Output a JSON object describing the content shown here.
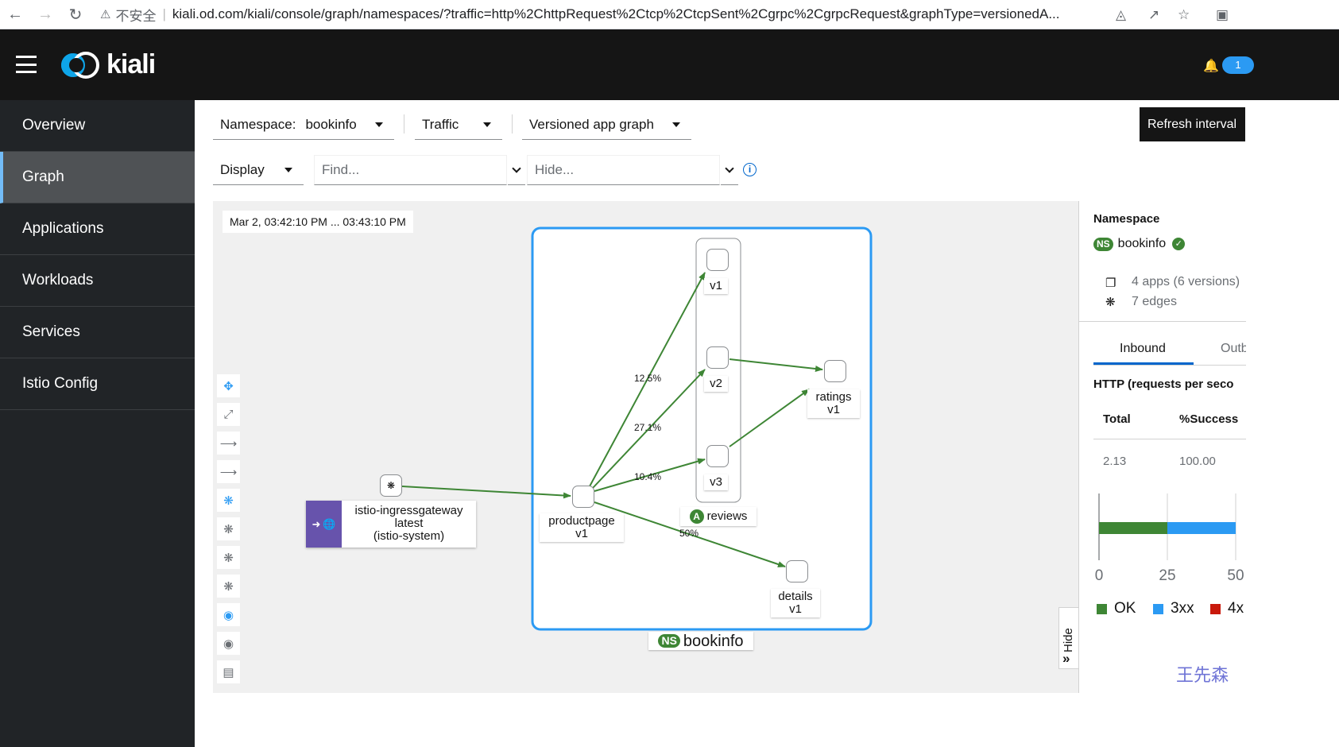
{
  "browser": {
    "insecure_label": "不安全",
    "url": "kiali.od.com/kiali/console/graph/namespaces/?traffic=http%2ChttpRequest%2Ctcp%2CtcpSent%2Cgrpc%2CgrpcRequest&graphType=versionedA..."
  },
  "masthead": {
    "logo_text": "kiali",
    "notification_count": "1"
  },
  "sidebar": {
    "items": [
      {
        "label": "Overview"
      },
      {
        "label": "Graph"
      },
      {
        "label": "Applications"
      },
      {
        "label": "Workloads"
      },
      {
        "label": "Services"
      },
      {
        "label": "Istio Config"
      }
    ],
    "active": "Graph"
  },
  "toolbar": {
    "namespace_label": "Namespace:",
    "namespace_value": "bookinfo",
    "traffic_label": "Traffic",
    "graph_type": "Versioned app graph",
    "display_label": "Display",
    "find_placeholder": "Find...",
    "hide_placeholder": "Hide...",
    "refresh_tooltip": "Refresh interval"
  },
  "graph": {
    "time_range": "Mar 2, 03:42:10 PM ... 03:43:10 PM",
    "namespace_box_label": "bookinfo",
    "ns_badge": "NS",
    "app_badge": "A",
    "nodes": {
      "gateway": {
        "line1": "istio-ingressgateway",
        "line2": "latest",
        "line3": "(istio-system)"
      },
      "productpage": {
        "line1": "productpage",
        "line2": "v1"
      },
      "reviews_v1": {
        "line1": "v1"
      },
      "reviews_v2": {
        "line1": "v2"
      },
      "reviews_v3": {
        "line1": "v3"
      },
      "reviews_app": {
        "line1": "reviews"
      },
      "ratings": {
        "line1": "ratings",
        "line2": "v1"
      },
      "details": {
        "line1": "details",
        "line2": "v1"
      }
    },
    "edge_labels": {
      "to_v1": "12.5%",
      "to_v2": "27.1%",
      "to_v3": "10.4%",
      "to_details": "50%"
    },
    "edge_color": "#3e8635",
    "namespace_box_color": "#2b9af3",
    "hide_label": "Hide"
  },
  "summary": {
    "title": "Namespace",
    "namespace_badge": "NS",
    "namespace_name": "bookinfo",
    "apps_stat": "4 apps (6 versions)",
    "edges_stat": "7 edges",
    "tabs": [
      "Inbound",
      "Outb"
    ],
    "active_tab": "Inbound",
    "http_heading": "HTTP (requests per seco",
    "table_headers": [
      "Total",
      "%Success"
    ],
    "table_values": [
      "2.13",
      "100.00"
    ],
    "watermark": "王先森"
  },
  "chart_data": {
    "type": "bar",
    "orientation": "horizontal",
    "stacked": true,
    "categories": [
      ""
    ],
    "series": [
      {
        "name": "OK",
        "color": "#3e8635",
        "values": [
          25
        ]
      },
      {
        "name": "3xx",
        "color": "#2b9af3",
        "values": [
          25
        ]
      },
      {
        "name": "4x",
        "color": "#c9190b",
        "values": [
          0
        ]
      }
    ],
    "x_ticks": [
      "0",
      "25",
      "50"
    ],
    "xlim": [
      0,
      50
    ],
    "legend_placement": "bottom"
  }
}
